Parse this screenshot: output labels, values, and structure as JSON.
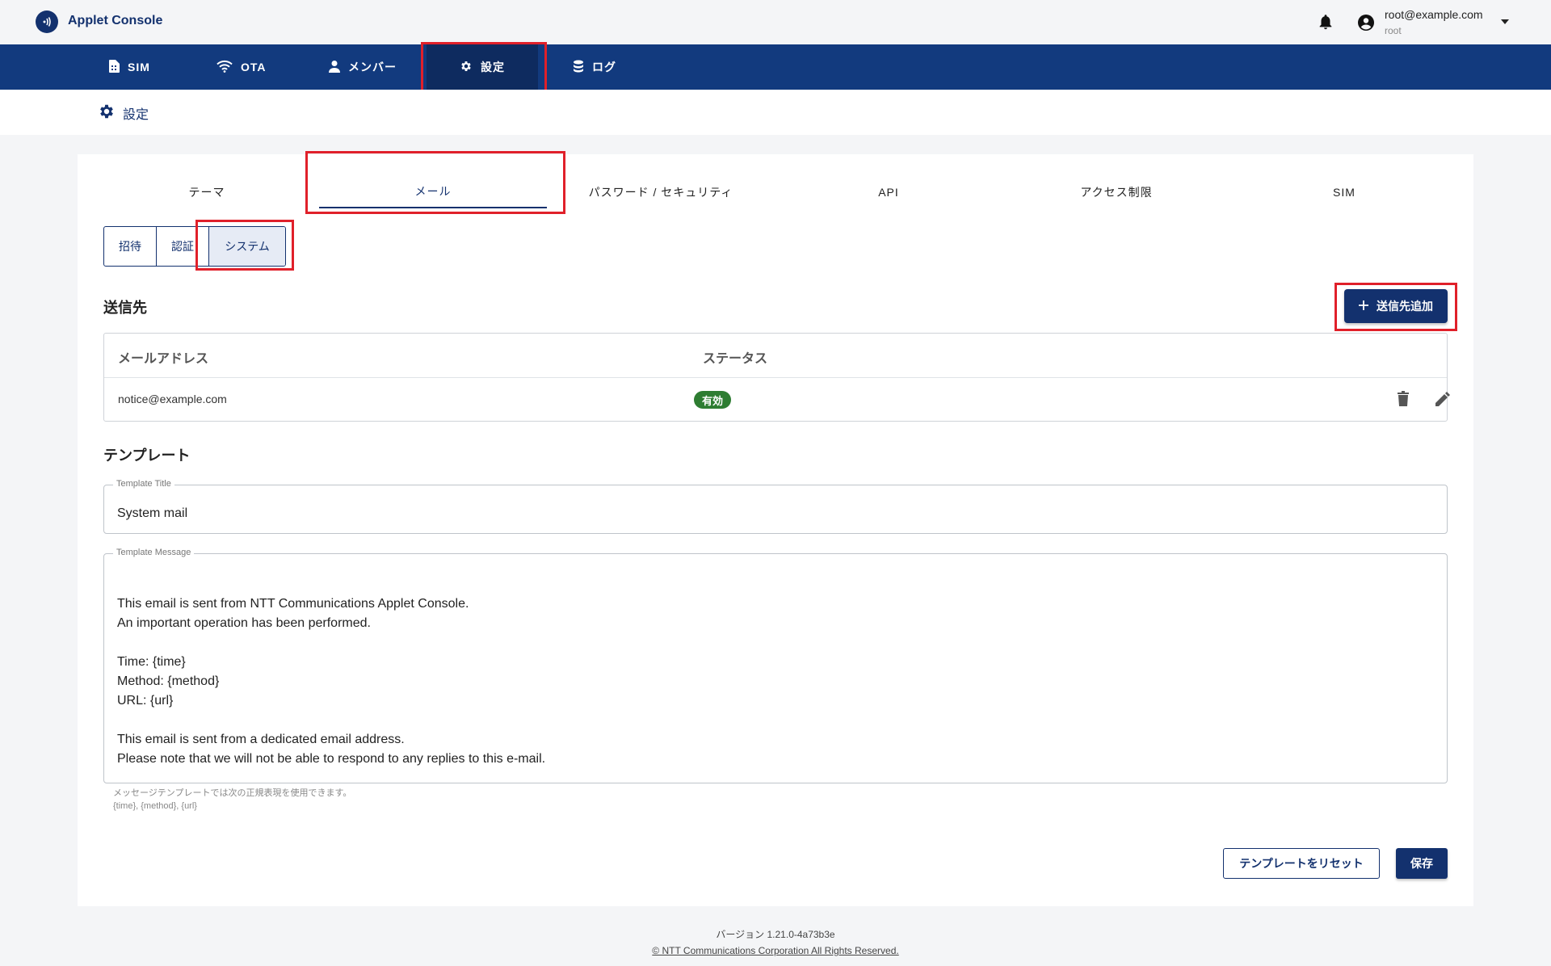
{
  "header": {
    "app_title": "Applet Console",
    "user_email": "root@example.com",
    "user_role": "root"
  },
  "nav": {
    "items": [
      {
        "label": "SIM",
        "icon": "sim-card-icon"
      },
      {
        "label": "OTA",
        "icon": "wifi-icon"
      },
      {
        "label": "メンバー",
        "icon": "person-icon"
      },
      {
        "label": "設定",
        "icon": "gear-icon",
        "active": true
      },
      {
        "label": "ログ",
        "icon": "database-icon"
      }
    ]
  },
  "breadcrumb": {
    "label": "設定"
  },
  "tabs": [
    {
      "label": "テーマ"
    },
    {
      "label": "メール",
      "active": true
    },
    {
      "label": "パスワード / セキュリティ"
    },
    {
      "label": "API"
    },
    {
      "label": "アクセス制限"
    },
    {
      "label": "SIM"
    }
  ],
  "subtabs": [
    {
      "label": "招待"
    },
    {
      "label": "認証"
    },
    {
      "label": "システム",
      "selected": true
    }
  ],
  "recipients": {
    "title": "送信先",
    "add_button": "送信先追加",
    "columns": [
      "メールアドレス",
      "ステータス"
    ],
    "rows": [
      {
        "email": "notice@example.com",
        "status": "有効"
      }
    ]
  },
  "template": {
    "title": "テンプレート",
    "title_field_label": "Template Title",
    "title_value": "System mail",
    "message_field_label": "Template Message",
    "message_lines": [
      "",
      "This email is sent from NTT Communications Applet Console.",
      "An important operation has been performed.",
      "",
      "Time: {time}",
      "Method: {method}",
      "URL: {url}",
      "",
      "This email is sent from a dedicated email address.",
      "Please note that we will not be able to respond to any replies to this e-mail."
    ],
    "helper_line1": "メッセージテンプレートでは次の正規表現を使用できます。",
    "helper_line2": "{time}, {method}, {url}",
    "reset_button": "テンプレートをリセット",
    "save_button": "保存"
  },
  "footer": {
    "version": "バージョン 1.21.0-4a73b3e",
    "copyright": "© NTT Communications Corporation All Rights Reserved."
  },
  "colors": {
    "primary": "#13316e",
    "nav_bg": "#123a7e",
    "highlight": "#e0202a",
    "status_active": "#2e7d32"
  }
}
